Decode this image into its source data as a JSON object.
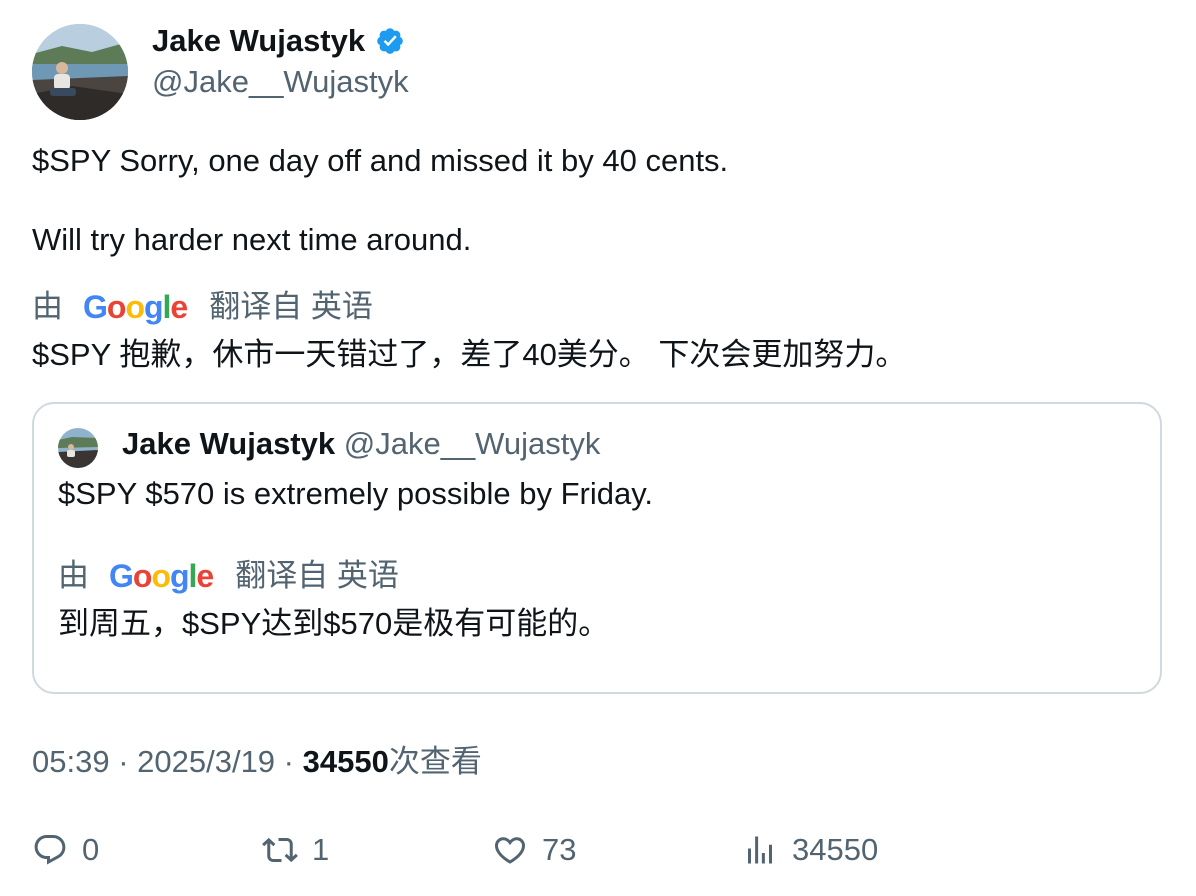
{
  "author": {
    "name": "Jake Wujastyk",
    "handle": "@Jake__Wujastyk",
    "verified_color": "#1d9bf0"
  },
  "tweet": {
    "line1": "$SPY Sorry, one day off and missed it by 40 cents.",
    "line2": "Will try harder next time around."
  },
  "translation": {
    "by": "由",
    "logo_text": "Google",
    "from": "翻译自 英语",
    "text": "$SPY 抱歉，休市一天错过了，差了40美分。 下次会更加努力。"
  },
  "quoted": {
    "name": "Jake Wujastyk",
    "handle": "@Jake__Wujastyk",
    "text": "$SPY $570 is extremely possible by Friday.",
    "translation": {
      "by": "由",
      "logo_text": "Google",
      "from": "翻译自 英语",
      "text": "到周五，$SPY达到$570是极有可能的。"
    }
  },
  "meta": {
    "time": "05:39",
    "sep": " · ",
    "date": "2025/3/19",
    "views": "34550",
    "views_label": "次查看"
  },
  "actions": {
    "replies": "0",
    "retweets": "1",
    "likes": "73",
    "views": "34550"
  },
  "colors": {
    "text": "#0f1419",
    "muted": "#536471",
    "border": "#cfd9de",
    "google_blue": "#4285F4",
    "google_red": "#EA4335",
    "google_yellow": "#FBBC05",
    "google_green": "#34A853"
  }
}
